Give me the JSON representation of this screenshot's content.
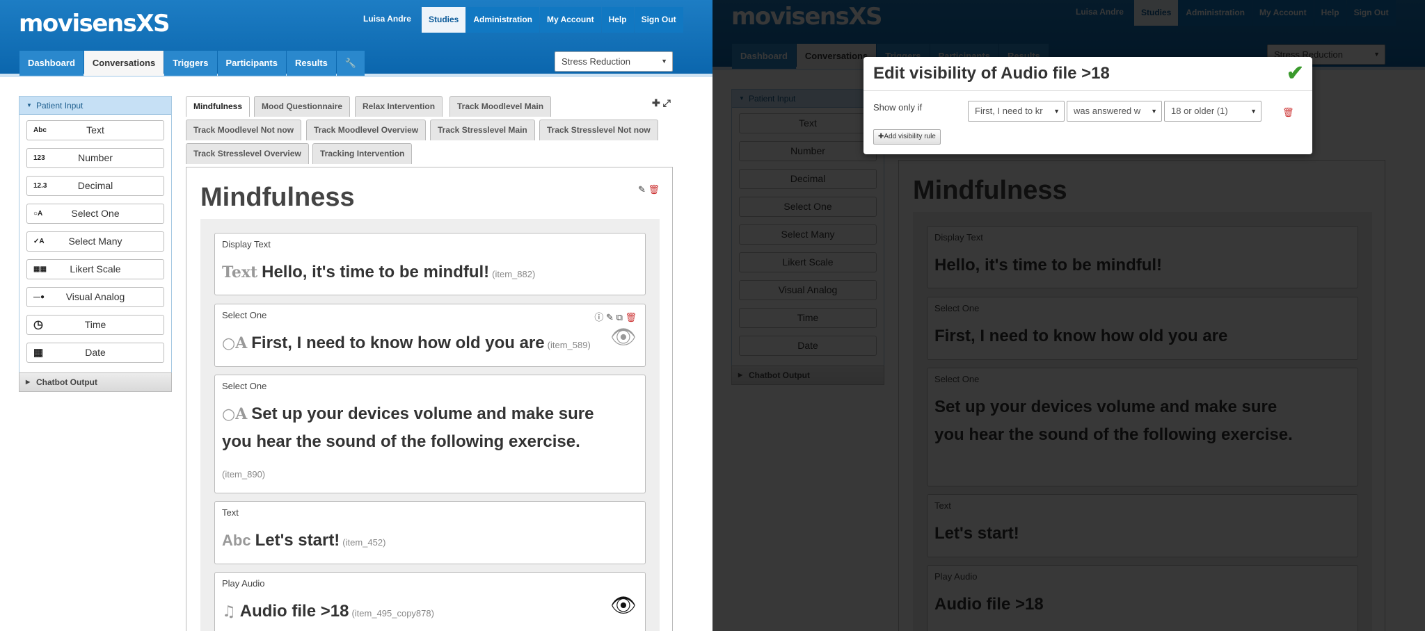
{
  "header": {
    "logo": "movisensXS",
    "username": "Luisa Andre",
    "top_nav": [
      "Studies",
      "Administration",
      "My Account",
      "Help",
      "Sign Out"
    ],
    "main_nav": [
      "Dashboard",
      "Conversations",
      "Triggers",
      "Participants",
      "Results"
    ],
    "study_select": "Stress Reduction"
  },
  "palette": {
    "heading": "Patient Input",
    "items": [
      {
        "label": "Text",
        "icon": "Abc"
      },
      {
        "label": "Number",
        "icon": "123"
      },
      {
        "label": "Decimal",
        "icon": "12.3"
      },
      {
        "label": "Select One",
        "icon": "select-one-icon"
      },
      {
        "label": "Select Many",
        "icon": "select-many-icon"
      },
      {
        "label": "Likert Scale",
        "icon": "likert-icon"
      },
      {
        "label": "Visual Analog",
        "icon": "slider-icon"
      },
      {
        "label": "Time",
        "icon": "clock-icon"
      },
      {
        "label": "Date",
        "icon": "calendar-icon"
      }
    ],
    "chatbot_heading": "Chatbot Output"
  },
  "tabs": [
    "Mindfulness",
    "Mood Questionnaire",
    "Relax Intervention",
    "Track Moodlevel Main",
    "Track Moodlevel Not now",
    "Track Moodlevel Overview",
    "Track Stresslevel Main",
    "Track Stresslevel Not now",
    "Track Stresslevel Overview",
    "Tracking Intervention"
  ],
  "conversation": {
    "title": "Mindfulness",
    "items": [
      {
        "type": "Display Text",
        "icon": "Text",
        "label": "Hello, it's time to be mindful!",
        "id": "(item_882)"
      },
      {
        "type": "Select One",
        "icon": "select-one-icon",
        "label": "First, I need to know how old you are",
        "id": "(item_589)"
      },
      {
        "type": "Select One",
        "icon": "select-one-icon",
        "label_line1": "Set up your devices volume and make sure",
        "label_line2": "you hear the sound of the following exercise.",
        "id": "(item_890)"
      },
      {
        "type": "Text",
        "icon": "Abc",
        "label": "Let's start!",
        "id": "(item_452)"
      },
      {
        "type": "Play Audio",
        "icon": "music-note-icon",
        "label": "Audio file >18",
        "id": "(item_495_copy878)"
      }
    ]
  },
  "modal": {
    "title": "Edit visibility of Audio file >18",
    "show_only_if": "Show only if",
    "question_select": "First, I need to kr",
    "operator_select": "was answered w",
    "answer_select": "18 or older (1)",
    "add_rule": "Add visibility rule"
  },
  "colors": {
    "header": "#0b66ad",
    "accent": "#2a88cd",
    "confirm": "#3a9a2c",
    "delete": "#cc3333"
  }
}
